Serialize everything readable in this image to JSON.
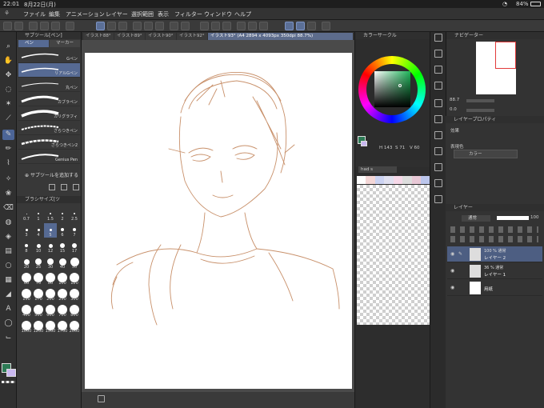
{
  "status": {
    "time": "22:01",
    "date": "8月22日(月)",
    "battery": "84%"
  },
  "menu": [
    "ファイル",
    "編集",
    "アニメーション",
    "レイヤー",
    "選択範囲",
    "表示",
    "フィルター",
    "ウィンドウ",
    "ヘルプ"
  ],
  "tabs": [
    "イラスト88°",
    "イラスト89°",
    "イラスト90°",
    "イラスト92°",
    "イラスト93° (A4 2894 x 4093px 350dpi 88.7%)"
  ],
  "subtool": {
    "title": "サブツール[ペン]",
    "tabs": [
      "ペン",
      "マーカー"
    ],
    "brushes": [
      "Gペン",
      "リアルGペン",
      "丸ペン",
      "カブラペン",
      "カリグラフィ",
      "ざらつきペン",
      "ざらつきペン2",
      "Genius Pen"
    ],
    "add": "サブツールを追加する"
  },
  "brushsize": {
    "title": "ブラシサイズ[ツ",
    "sizes": [
      "0.7",
      "1",
      "1.5",
      "2",
      "2.5",
      "3",
      "4",
      "5",
      "6",
      "7",
      "8",
      "10",
      "12",
      "15",
      "17",
      "20",
      "25",
      "30",
      "40",
      "50",
      "60",
      "70",
      "80",
      "100",
      "120",
      "150",
      "170",
      "200",
      "250",
      "300",
      "400",
      "500",
      "600",
      "700",
      "800",
      "1000",
      "1200",
      "1500",
      "1700",
      "2000"
    ]
  },
  "colorcircle": {
    "title": "カラーサークル",
    "values": {
      "h": "143",
      "s": "71",
      "v": "60"
    }
  },
  "colorset": {
    "title": "had s"
  },
  "navigator": {
    "title": "ナビゲーター",
    "zoom": "88.7",
    "angle": "0.0"
  },
  "layerprop": {
    "title": "レイヤープロパティ",
    "effect": "効果",
    "express": "表現色",
    "color": "カラー"
  },
  "layers": {
    "title": "レイヤー",
    "blend": "通常",
    "opacity": "100",
    "items": [
      {
        "mode": "100 % 通常",
        "name": "レイヤー 2"
      },
      {
        "mode": "36 % 通常",
        "name": "レイヤー 1"
      },
      {
        "mode": "",
        "name": "用紙"
      }
    ]
  },
  "colors": {
    "accent": "#5b6f96",
    "main": "#2d7a55",
    "sub": "#c9b8f0",
    "sketch": "#c8906a"
  }
}
